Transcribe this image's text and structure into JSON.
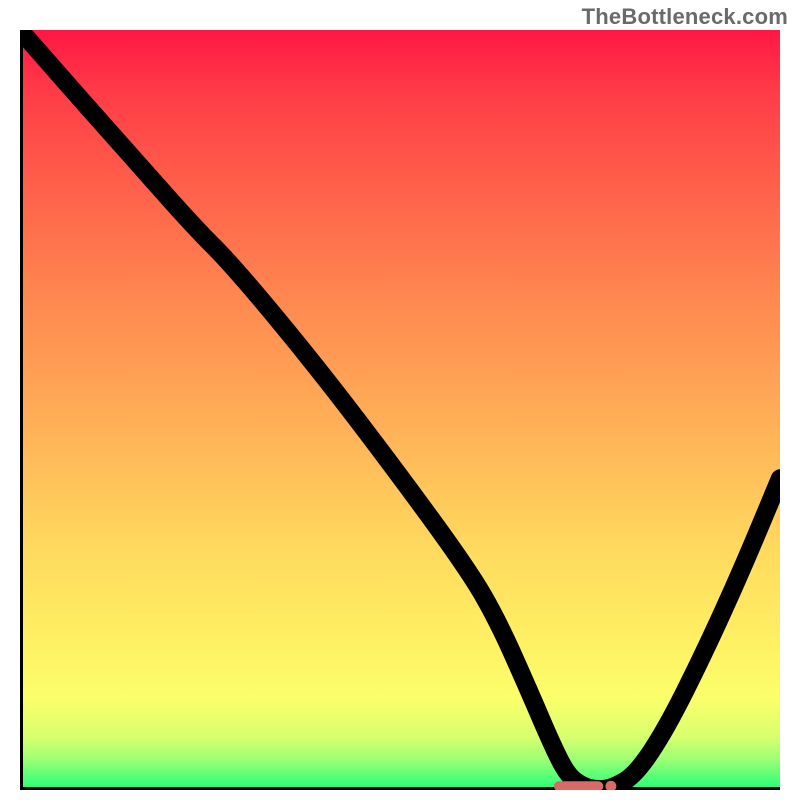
{
  "watermark_text": "TheBottleneck.com",
  "chart_data": {
    "type": "line",
    "title": "",
    "xlabel": "",
    "ylabel": "",
    "xlim": [
      0,
      100
    ],
    "ylim": [
      0,
      100
    ],
    "grid": false,
    "legend": false,
    "series": [
      {
        "name": "bottleneck-curve",
        "x": [
          0,
          7,
          15,
          23,
          28,
          38,
          48,
          59,
          63,
          67,
          70,
          72,
          74,
          76,
          78,
          81,
          85,
          90,
          95,
          100
        ],
        "y": [
          100,
          92,
          83,
          74,
          69,
          57,
          44,
          29,
          22,
          13,
          6,
          2,
          0.5,
          0,
          0.3,
          2,
          8,
          18,
          29,
          41
        ]
      }
    ],
    "annotations": [
      {
        "name": "optimal-marker",
        "type": "pill",
        "x": 73.5,
        "y": 0.5,
        "width_frac": 0.065,
        "height_frac": 0.013,
        "color": "#d96a66",
        "dot_offset_frac": 0.01
      }
    ],
    "background_gradient": {
      "stops": [
        {
          "pos": 0.0,
          "color": "#ff1744"
        },
        {
          "pos": 0.08,
          "color": "#ff3b47"
        },
        {
          "pos": 0.2,
          "color": "#ff5e4a"
        },
        {
          "pos": 0.35,
          "color": "#ff8750"
        },
        {
          "pos": 0.52,
          "color": "#ffb057"
        },
        {
          "pos": 0.68,
          "color": "#ffd95e"
        },
        {
          "pos": 0.8,
          "color": "#ffef63"
        },
        {
          "pos": 0.88,
          "color": "#fbff6a"
        },
        {
          "pos": 0.93,
          "color": "#d8ff6e"
        },
        {
          "pos": 0.96,
          "color": "#9cff74"
        },
        {
          "pos": 1.0,
          "color": "#1eff7a"
        }
      ]
    }
  }
}
